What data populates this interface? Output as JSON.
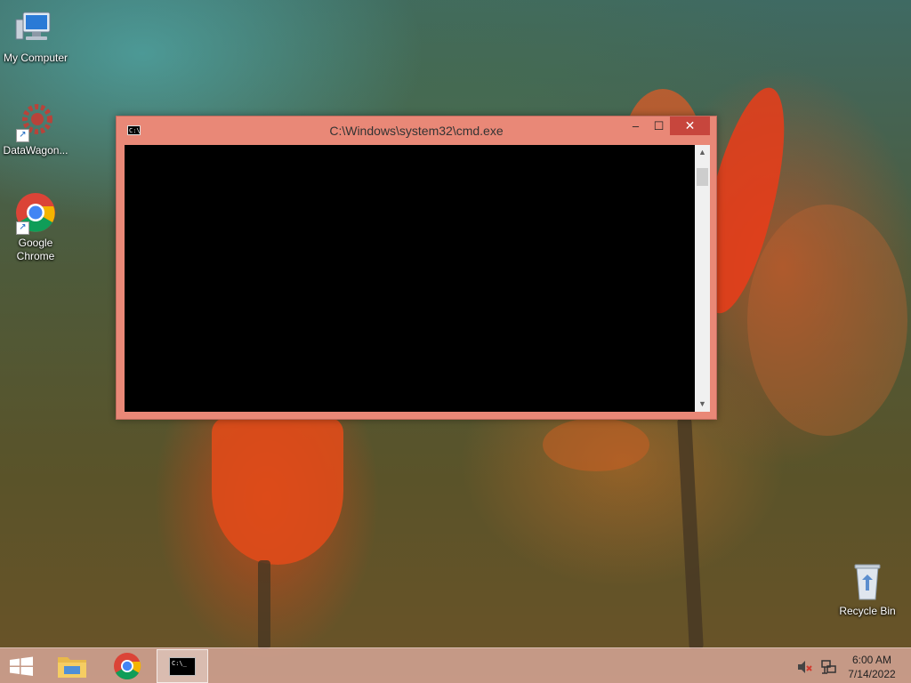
{
  "desktop": {
    "icons": [
      {
        "label": "My Computer",
        "icon": "computer-icon"
      },
      {
        "label": "DataWagon...",
        "icon": "gear-icon"
      },
      {
        "label": "Google Chrome",
        "icon": "chrome-icon"
      },
      {
        "label": "Recycle Bin",
        "icon": "recycle-bin-icon"
      }
    ]
  },
  "cmd_window": {
    "title": "C:\\Windows\\system32\\cmd.exe",
    "icon_text": "C:\\",
    "minimize_label": "–",
    "maximize_label": "☐",
    "close_label": "✕",
    "scroll_up_label": "▲",
    "scroll_down_label": "▼"
  },
  "taskbar": {
    "items": [
      {
        "name": "start",
        "icon": "windows-logo-icon"
      },
      {
        "name": "file-explorer",
        "icon": "folder-icon"
      },
      {
        "name": "chrome",
        "icon": "chrome-icon"
      },
      {
        "name": "cmd",
        "icon": "cmd-icon",
        "icon_text": "C:\\_"
      }
    ],
    "tray": {
      "volume_icon": "speaker-muted-icon",
      "network_icon": "network-icon",
      "time": "6:00 AM",
      "date": "7/14/2022"
    }
  },
  "colors": {
    "window_frame": "#e98877",
    "close_button": "#c7463d",
    "console_bg": "#000000"
  }
}
